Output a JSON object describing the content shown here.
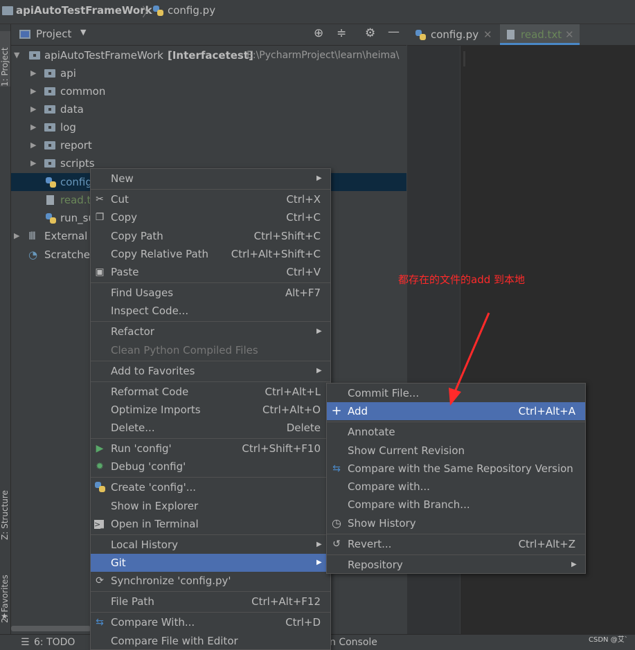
{
  "breadcrumb": {
    "project": "apiAutoTestFrameWork",
    "file": "config.py"
  },
  "left_strip": {
    "project_label": "1: Project",
    "structure_label": "Z: Structure",
    "favorites_label": "2: Favorites"
  },
  "project_panel": {
    "title": "Project"
  },
  "tree": {
    "root": {
      "name": "apiAutoTestFrameWork",
      "module": "[Interfacetest]",
      "path": "E:\\PycharmProject\\learn\\heima\\"
    },
    "folders": [
      "api",
      "common",
      "data",
      "log",
      "report",
      "scripts"
    ],
    "files": [
      {
        "name": "config",
        "color": "#6897bb"
      },
      {
        "name": "read.t",
        "color": "#6a8759"
      },
      {
        "name": "run_su",
        "color": "#bbbbbb"
      }
    ],
    "external": "External l",
    "scratches": "Scratches"
  },
  "editor": {
    "tabs": [
      {
        "label": "config.py"
      },
      {
        "label": "read.txt"
      }
    ]
  },
  "bottom_bar": {
    "todo": "6: TODO",
    "console": "n Console"
  },
  "context_menu": {
    "items": [
      {
        "label": "New",
        "shortcut": "",
        "submenu": true
      },
      {
        "label": "Cut",
        "shortcut": "Ctrl+X",
        "icon": "scissors-icon"
      },
      {
        "label": "Copy",
        "shortcut": "Ctrl+C",
        "icon": "copy-icon"
      },
      {
        "label": "Copy Path",
        "shortcut": "Ctrl+Shift+C"
      },
      {
        "label": "Copy Relative Path",
        "shortcut": "Ctrl+Alt+Shift+C"
      },
      {
        "label": "Paste",
        "shortcut": "Ctrl+V",
        "icon": "paste-icon"
      },
      {
        "label": "Find Usages",
        "shortcut": "Alt+F7"
      },
      {
        "label": "Inspect Code...",
        "shortcut": ""
      },
      {
        "label": "Refactor",
        "shortcut": "",
        "submenu": true
      },
      {
        "label": "Clean Python Compiled Files",
        "shortcut": "",
        "disabled": true
      },
      {
        "label": "Add to Favorites",
        "shortcut": "",
        "submenu": true
      },
      {
        "label": "Reformat Code",
        "shortcut": "Ctrl+Alt+L"
      },
      {
        "label": "Optimize Imports",
        "shortcut": "Ctrl+Alt+O"
      },
      {
        "label": "Delete...",
        "shortcut": "Delete"
      },
      {
        "label": "Run 'config'",
        "shortcut": "Ctrl+Shift+F10",
        "icon": "run-icon"
      },
      {
        "label": "Debug 'config'",
        "shortcut": "",
        "icon": "debug-icon"
      },
      {
        "label": "Create 'config'...",
        "shortcut": "",
        "icon": "python-icon"
      },
      {
        "label": "Show in Explorer",
        "shortcut": ""
      },
      {
        "label": "Open in Terminal",
        "shortcut": "",
        "icon": "terminal-icon"
      },
      {
        "label": "Local History",
        "shortcut": "",
        "submenu": true
      },
      {
        "label": "Git",
        "shortcut": "",
        "submenu": true,
        "highlighted": true
      },
      {
        "label": "Synchronize 'config.py'",
        "shortcut": "",
        "icon": "sync-icon"
      },
      {
        "label": "File Path",
        "shortcut": "Ctrl+Alt+F12"
      },
      {
        "label": "Compare With...",
        "shortcut": "Ctrl+D",
        "icon": "compare-icon"
      },
      {
        "label": "Compare File with Editor",
        "shortcut": ""
      }
    ]
  },
  "git_menu": {
    "items": [
      {
        "label": "Commit File...",
        "shortcut": ""
      },
      {
        "label": "Add",
        "shortcut": "Ctrl+Alt+A",
        "icon": "plus-icon",
        "highlighted": true
      },
      {
        "label": "Annotate",
        "shortcut": ""
      },
      {
        "label": "Show Current Revision",
        "shortcut": ""
      },
      {
        "label": "Compare with the Same Repository Version",
        "shortcut": "",
        "icon": "compare-icon"
      },
      {
        "label": "Compare with...",
        "shortcut": ""
      },
      {
        "label": "Compare with Branch...",
        "shortcut": ""
      },
      {
        "label": "Show History",
        "shortcut": "",
        "icon": "clock-icon"
      },
      {
        "label": "Revert...",
        "shortcut": "Ctrl+Alt+Z",
        "icon": "revert-icon"
      },
      {
        "label": "Repository",
        "shortcut": "",
        "submenu": true
      }
    ]
  },
  "annotation": {
    "text": "都存在的文件的add 到本地",
    "color": "#ff2a2a"
  },
  "watermark": "CSDN @艾`"
}
